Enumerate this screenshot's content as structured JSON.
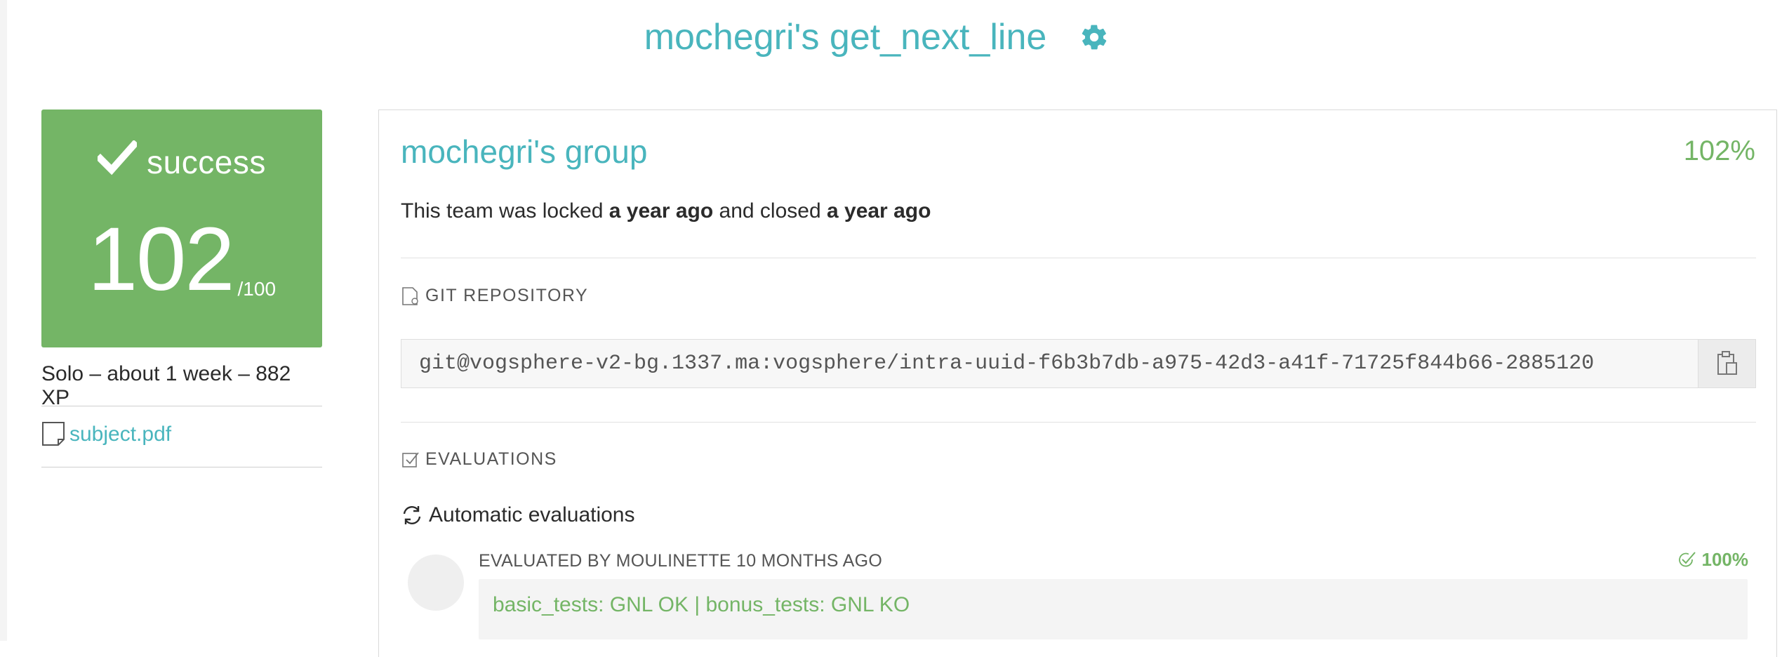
{
  "header": {
    "title": "mochegri's get_next_line",
    "settings_icon": "gear-icon"
  },
  "status_card": {
    "status": "success",
    "score": "102",
    "score_max": "/100",
    "color": "#74b566"
  },
  "project": {
    "meta": "Solo – about 1 week – 882 XP",
    "subject_link": "subject.pdf"
  },
  "team": {
    "group_name": "mochegri's group",
    "percent": "102%",
    "status_prefix": "This team was locked ",
    "locked_time": "a year ago",
    "status_middle": " and closed ",
    "closed_time": "a year ago"
  },
  "git": {
    "heading": "GIT REPOSITORY",
    "repo_url": "git@vogsphere-v2-bg.1337.ma:vogsphere/intra-uuid-f6b3b7db-a975-42d3-a41f-71725f844b66-2885120"
  },
  "evaluations": {
    "heading": "EVALUATIONS",
    "auto_label": "Automatic evaluations",
    "evaluated_by": "EVALUATED BY MOULINETTE 10 MONTHS AGO",
    "score": "100%",
    "result": "basic_tests: GNL OK | bonus_tests: GNL KO"
  },
  "colors": {
    "accent": "#49b5bd",
    "success": "#74b566"
  }
}
